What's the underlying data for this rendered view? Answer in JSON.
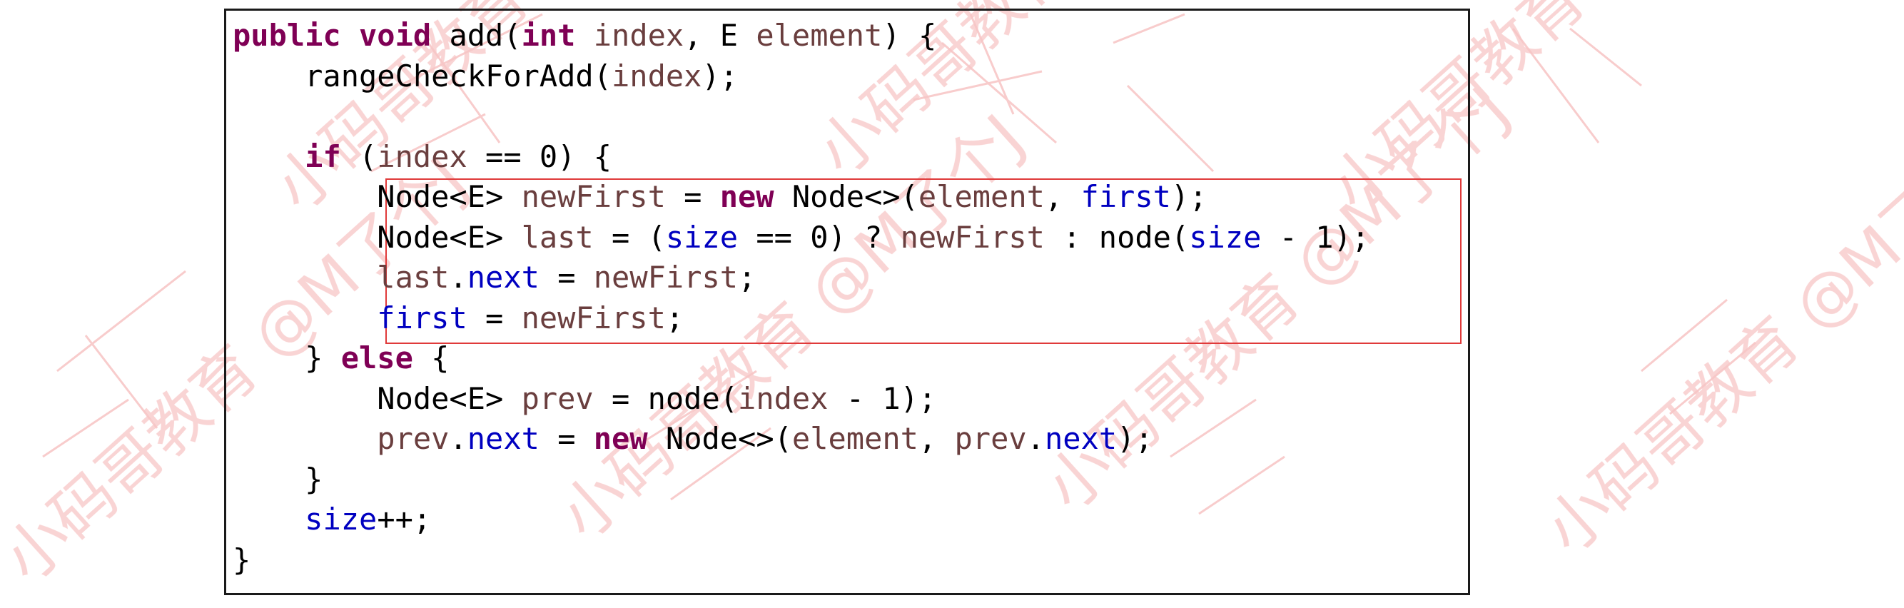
{
  "watermark": {
    "text": "小码哥教育 @M了个J",
    "color": "#f7c6c6"
  },
  "code": {
    "lines": [
      [
        [
          "kw",
          "public"
        ],
        [
          "p",
          " "
        ],
        [
          "kw",
          "void"
        ],
        [
          "p",
          " add("
        ],
        [
          "kw",
          "int"
        ],
        [
          "p",
          " "
        ],
        [
          "var",
          "index"
        ],
        [
          "p",
          ", E "
        ],
        [
          "var",
          "element"
        ],
        [
          "p",
          ") {"
        ]
      ],
      [
        [
          "p",
          "    rangeCheckForAdd("
        ],
        [
          "var",
          "index"
        ],
        [
          "p",
          ");"
        ]
      ],
      [
        [
          "p",
          ""
        ]
      ],
      [
        [
          "p",
          "    "
        ],
        [
          "kw",
          "if"
        ],
        [
          "p",
          " ("
        ],
        [
          "var",
          "index"
        ],
        [
          "p",
          " == 0) {"
        ]
      ],
      [
        [
          "p",
          "        Node<E> "
        ],
        [
          "var",
          "newFirst"
        ],
        [
          "p",
          " = "
        ],
        [
          "kw",
          "new"
        ],
        [
          "p",
          " Node<>("
        ],
        [
          "var",
          "element"
        ],
        [
          "p",
          ", "
        ],
        [
          "fld",
          "first"
        ],
        [
          "p",
          ");"
        ]
      ],
      [
        [
          "p",
          "        Node<E> "
        ],
        [
          "var",
          "last"
        ],
        [
          "p",
          " = ("
        ],
        [
          "fld",
          "size"
        ],
        [
          "p",
          " == 0) ? "
        ],
        [
          "var",
          "newFirst"
        ],
        [
          "p",
          " : node("
        ],
        [
          "fld",
          "size"
        ],
        [
          "p",
          " - 1);"
        ]
      ],
      [
        [
          "p",
          "        "
        ],
        [
          "var",
          "last"
        ],
        [
          "p",
          "."
        ],
        [
          "fld",
          "next"
        ],
        [
          "p",
          " = "
        ],
        [
          "var",
          "newFirst"
        ],
        [
          "p",
          ";"
        ]
      ],
      [
        [
          "p",
          "        "
        ],
        [
          "fld",
          "first"
        ],
        [
          "p",
          " = "
        ],
        [
          "var",
          "newFirst"
        ],
        [
          "p",
          ";"
        ]
      ],
      [
        [
          "p",
          "    } "
        ],
        [
          "kw",
          "else"
        ],
        [
          "p",
          " {"
        ]
      ],
      [
        [
          "p",
          "        Node<E> "
        ],
        [
          "var",
          "prev"
        ],
        [
          "p",
          " = node("
        ],
        [
          "var",
          "index"
        ],
        [
          "p",
          " - 1);"
        ]
      ],
      [
        [
          "p",
          "        "
        ],
        [
          "var",
          "prev"
        ],
        [
          "p",
          "."
        ],
        [
          "fld",
          "next"
        ],
        [
          "p",
          " = "
        ],
        [
          "kw",
          "new"
        ],
        [
          "p",
          " Node<>("
        ],
        [
          "var",
          "element"
        ],
        [
          "p",
          ", "
        ],
        [
          "var",
          "prev"
        ],
        [
          "p",
          "."
        ],
        [
          "fld",
          "next"
        ],
        [
          "p",
          ");"
        ]
      ],
      [
        [
          "p",
          "    }"
        ]
      ],
      [
        [
          "p",
          "    "
        ],
        [
          "fld",
          "size"
        ],
        [
          "p",
          "++;"
        ]
      ],
      [
        [
          "p",
          "}"
        ]
      ]
    ],
    "colors": {
      "keyword": "#7f0055",
      "variable": "#6a3e3e",
      "field": "#0000c0",
      "plain": "#000000",
      "highlight_border": "#e03a3a"
    }
  }
}
